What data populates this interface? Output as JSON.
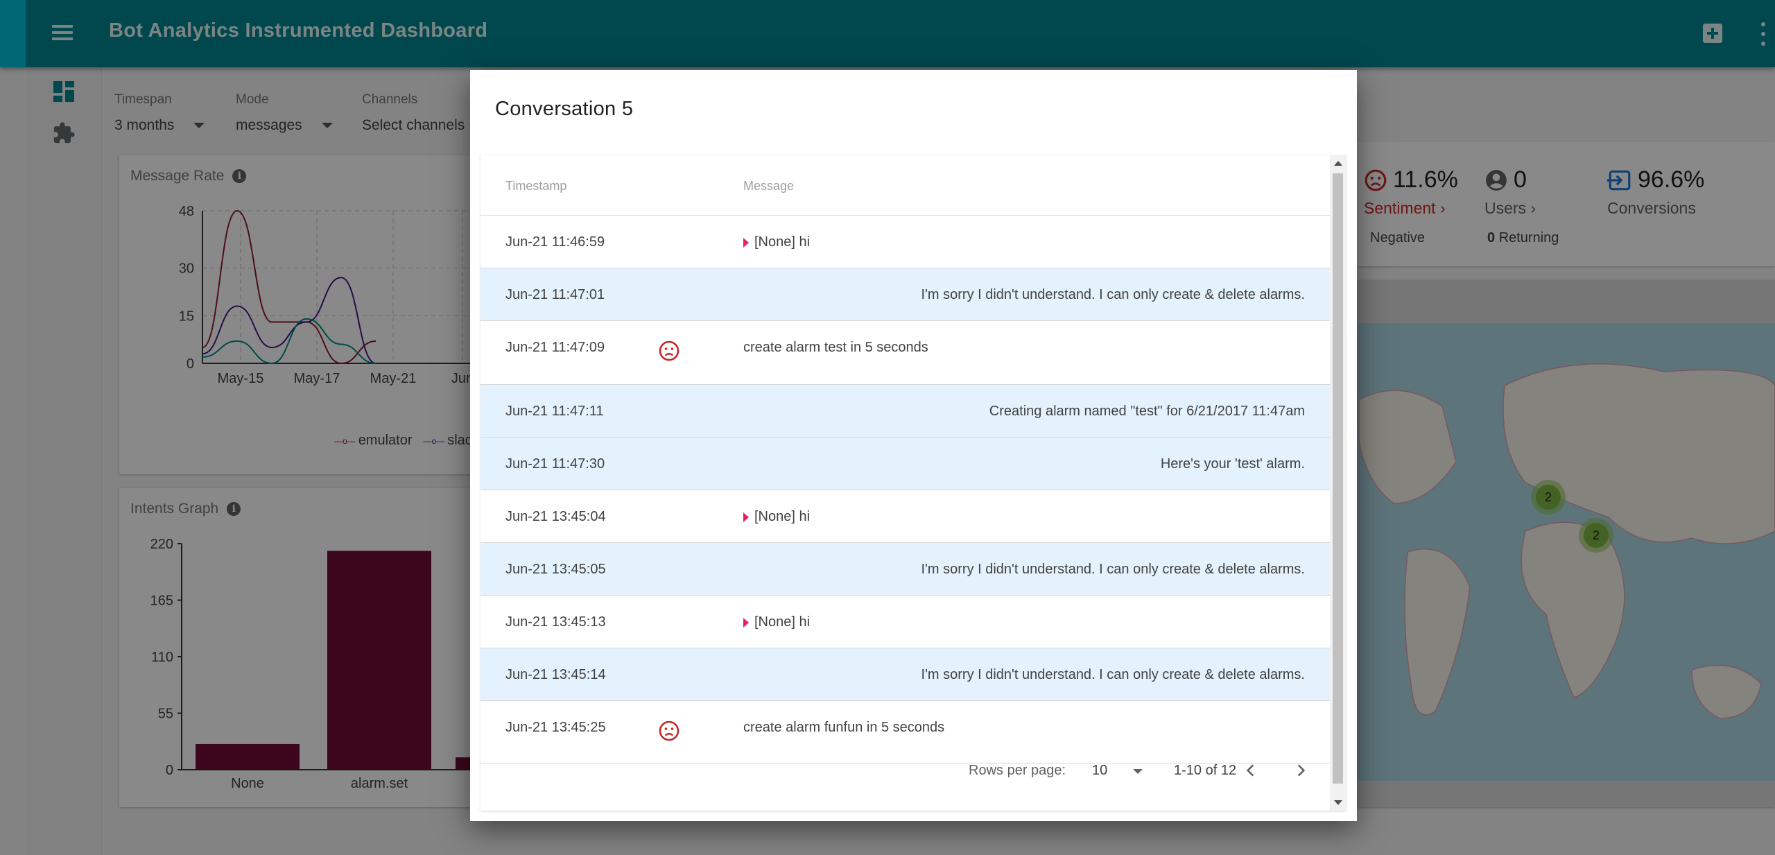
{
  "appbar": {
    "title": "Bot Analytics Instrumented Dashboard"
  },
  "filters": {
    "timespan": {
      "label": "Timespan",
      "value": "3 months"
    },
    "mode": {
      "label": "Mode",
      "value": "messages"
    },
    "channels": {
      "label": "Channels",
      "value": "Select channels"
    }
  },
  "cards": {
    "message_rate": {
      "title": "Message Rate"
    },
    "intents": {
      "title": "Intents Graph"
    }
  },
  "chart_data": [
    {
      "type": "line",
      "title": "Message Rate",
      "x": [
        "May-15",
        "May-17",
        "May-21",
        "Jun"
      ],
      "yticks": [
        0,
        15,
        30,
        48
      ],
      "ylim": [
        0,
        48
      ],
      "series": [
        {
          "name": "emulator",
          "values": [
            5,
            48,
            13,
            13,
            0,
            7
          ]
        },
        {
          "name": "slack",
          "values": [
            3,
            18,
            5,
            13,
            27,
            0
          ]
        },
        {
          "name": "",
          "values": [
            2,
            7,
            0,
            14,
            6,
            0
          ]
        }
      ],
      "legend": "bottom"
    },
    {
      "type": "bar",
      "title": "Intents Graph",
      "categories": [
        "None",
        "alarm.set"
      ],
      "values": [
        25,
        213
      ],
      "yticks": [
        0,
        55,
        110,
        165,
        220
      ],
      "ylim": [
        0,
        220
      ]
    }
  ],
  "kpis": {
    "sentiment": {
      "value": "11.6%",
      "caption": "Sentiment",
      "sub": "Negative"
    },
    "users": {
      "value": "0",
      "caption": "Users",
      "sub_count": "0",
      "sub": "Returning"
    },
    "conversions": {
      "value": "96.6%",
      "caption": "Conversions"
    }
  },
  "map": {
    "clusters": [
      "2",
      "2"
    ]
  },
  "colors": {
    "appbar": "#00838f",
    "accent": "#00bcd4",
    "bar": "#6d0b35",
    "bot_row": "#e3f2fd",
    "sentiment": "#c62828"
  },
  "dialog": {
    "title": "Conversation 5",
    "columns": {
      "timestamp": "Timestamp",
      "message": "Message"
    },
    "rows": [
      {
        "ts": "Jun-21 11:46:59",
        "msg": "[None] hi",
        "from": "user",
        "sad": false
      },
      {
        "ts": "Jun-21 11:47:01",
        "msg": "I'm sorry I didn't understand. I can only create & delete alarms.",
        "from": "bot",
        "sad": false
      },
      {
        "ts": "Jun-21 11:47:09",
        "msg": "create alarm test in 5 seconds",
        "from": "user",
        "sad": true
      },
      {
        "ts": "Jun-21 11:47:11",
        "msg": "Creating alarm named \"test\" for 6/21/2017 11:47am",
        "from": "bot",
        "sad": false
      },
      {
        "ts": "Jun-21 11:47:30",
        "msg": "Here's your 'test' alarm.",
        "from": "bot",
        "sad": false
      },
      {
        "ts": "Jun-21 13:45:04",
        "msg": "[None] hi",
        "from": "user",
        "sad": false
      },
      {
        "ts": "Jun-21 13:45:05",
        "msg": "I'm sorry I didn't understand. I can only create & delete alarms.",
        "from": "bot",
        "sad": false
      },
      {
        "ts": "Jun-21 13:45:13",
        "msg": "[None] hi",
        "from": "user",
        "sad": false
      },
      {
        "ts": "Jun-21 13:45:14",
        "msg": "I'm sorry I didn't understand. I can only create & delete alarms.",
        "from": "bot",
        "sad": false
      },
      {
        "ts": "Jun-21 13:45:25",
        "msg": "create alarm funfun in 5 seconds",
        "from": "user",
        "sad": true
      }
    ],
    "pager": {
      "rows_label": "Rows per page:",
      "rows_value": "10",
      "range": "1-10 of 12"
    }
  }
}
